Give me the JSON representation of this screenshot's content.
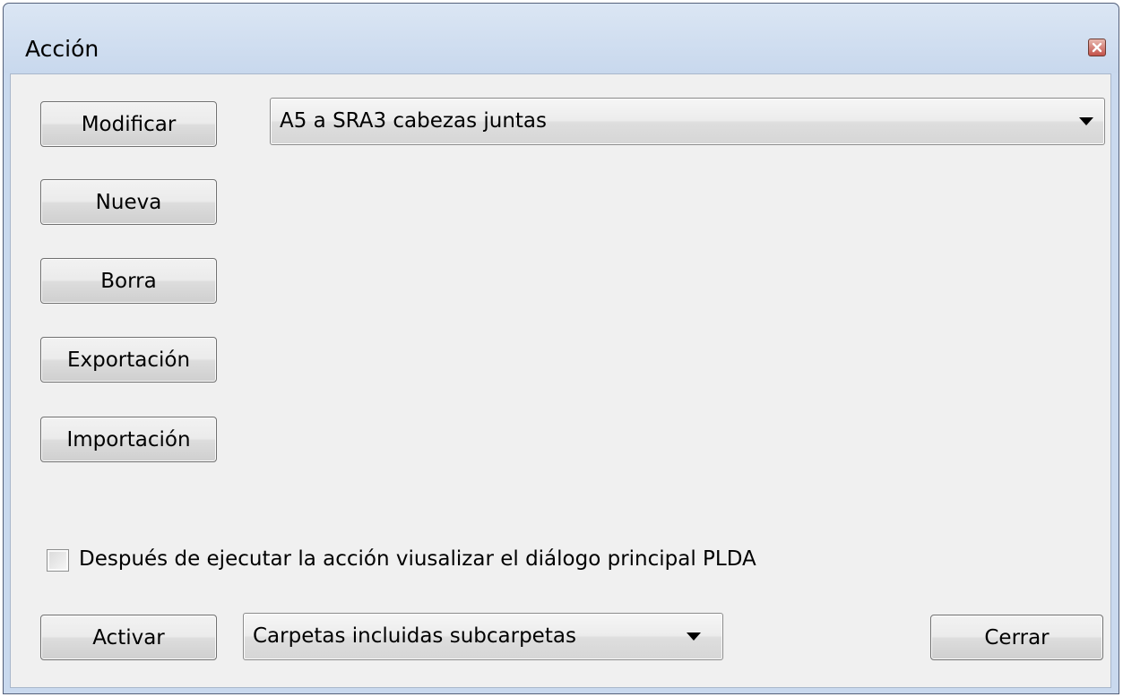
{
  "dialog": {
    "title": "Acción",
    "close_icon": "close-icon"
  },
  "buttons": {
    "modify": "Modificar",
    "new": "Nueva",
    "delete": "Borra",
    "export": "Exportación",
    "import": "Importación",
    "activate": "Activar",
    "close": "Cerrar"
  },
  "action_select": {
    "value": "A5 a SRA3 cabezas juntas"
  },
  "folder_select": {
    "value": "Carpetas incluidas subcarpetas"
  },
  "show_main_dialog": {
    "label": "Después de ejecutar la acción viusalizar el diálogo principal PLDA",
    "checked": false
  }
}
